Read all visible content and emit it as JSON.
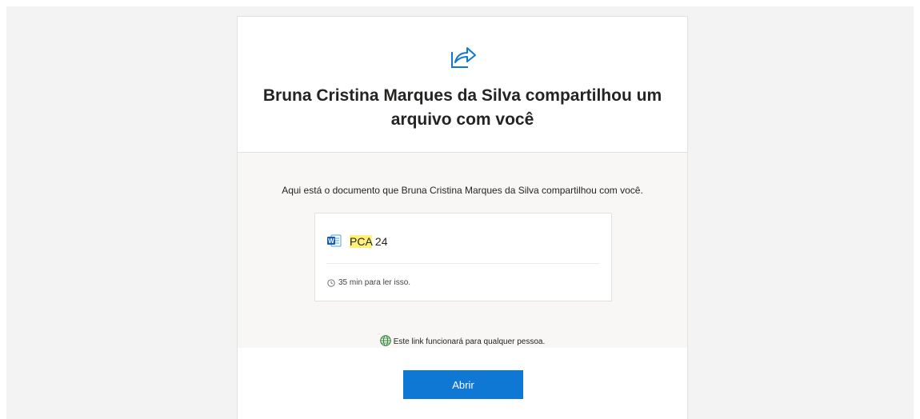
{
  "share": {
    "title": "Bruna Cristina Marques da Silva compartilhou um arquivo com você",
    "description": "Aqui está o documento que Bruna Cristina Marques da Silva compartilhou com você."
  },
  "file": {
    "name_highlight": "PCA",
    "name_rest": " 24",
    "read_time": "35 min para ler isso."
  },
  "link_note": "Este link funcionará para qualquer pessoa.",
  "actions": {
    "open_label": "Abrir"
  },
  "colors": {
    "accent": "#0f78d4",
    "highlight": "#fff176",
    "globe": "#2e7d32",
    "word_blue": "#185abd"
  },
  "icons": [
    "share-arrow-icon",
    "word-doc-icon",
    "clock-icon",
    "globe-icon"
  ]
}
